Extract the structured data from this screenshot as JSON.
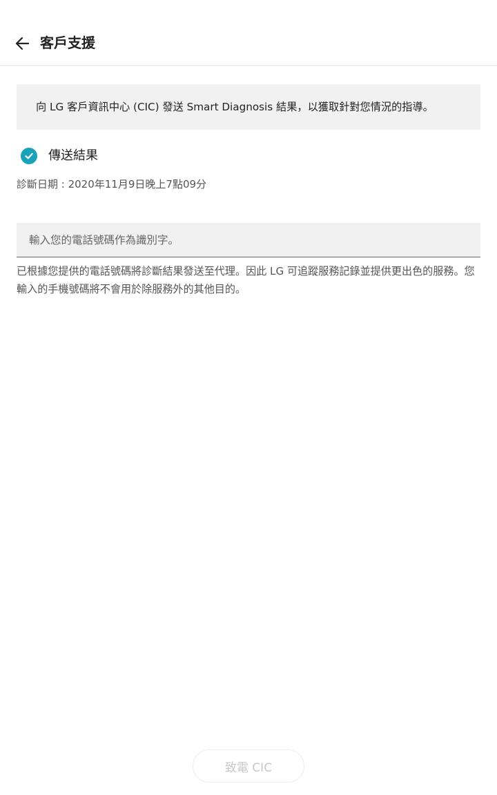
{
  "header": {
    "title": "客戶支援",
    "back_icon": "arrow-left-icon"
  },
  "banner": {
    "text": "向 LG 客戶資訊中心 (CIC) 發送 Smart Diagnosis 結果，以獲取針對您情況的指導。"
  },
  "send_result": {
    "label": "傳送結果",
    "checked": true,
    "check_color": "#1aa3b8",
    "icon": "check-circle-icon"
  },
  "diagnosis_date": "診斷日期 : 2020年11月9日晚上7點09分",
  "phone": {
    "placeholder": "輸入您的電話號碼作為識別字。",
    "value": ""
  },
  "notice": "已根據您提供的電話號碼將診斷結果發送至代理。因此 LG 可追蹤服務記錄並提供更出色的服務。您輸入的手機號碼將不會用於除服務外的其他目的。",
  "footer": {
    "call_button_label": "致電 CIC",
    "call_button_enabled": false
  }
}
